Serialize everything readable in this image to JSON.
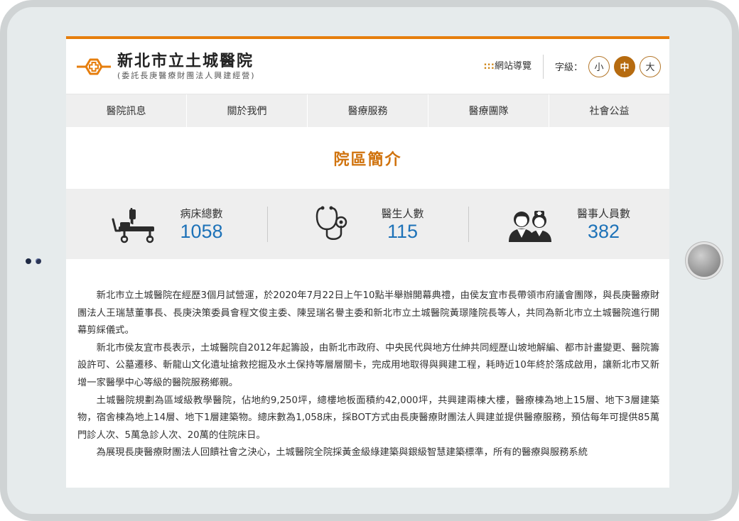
{
  "header": {
    "title": "新北市立土城醫院",
    "subtitle": "(委託長庚醫療財團法人興建經營)",
    "sitemap_dots": ":::",
    "sitemap_label": "網站導覽",
    "font_size_label": "字級：",
    "font_sizes": [
      "小",
      "中",
      "大"
    ],
    "active_font_size": "中",
    "accent_color": "#e67e0d"
  },
  "nav": {
    "items": [
      "醫院訊息",
      "關於我們",
      "醫療服務",
      "醫療團隊",
      "社會公益"
    ]
  },
  "page": {
    "title": "院區簡介"
  },
  "stats": [
    {
      "label": "病床總數",
      "value": "1058",
      "icon": "hospital-bed-icon"
    },
    {
      "label": "醫生人數",
      "value": "115",
      "icon": "stethoscope-icon"
    },
    {
      "label": "醫事人員數",
      "value": "382",
      "icon": "medical-staff-icon"
    }
  ],
  "article": {
    "paragraphs": [
      "新北市立土城醫院在經歷3個月試營運，於2020年7月22日上午10點半舉辦開幕典禮，由侯友宜市長帶領市府議會團隊，與長庚醫療財團法人王瑞慧董事長、長庚決策委員會程文俊主委、陳昱瑞名譽主委和新北市立土城醫院黃璟隆院長等人，共同為新北市立土城醫院進行開幕剪綵儀式。",
      "新北市侯友宜市長表示，土城醫院自2012年起籌設，由新北市政府、中央民代與地方仕紳共同經歷山坡地解編、都市計畫變更、醫院籌設許可、公墓遷移、斬龍山文化遺址搶救挖掘及水土保持等層層關卡，完成用地取得與興建工程，耗時近10年終於落成啟用，讓新北市又新增一家醫學中心等級的醫院服務鄉親。",
      "土城醫院規劃為區域級教學醫院，佔地約9,250坪，總樓地板面積約42,000坪，共興建兩棟大樓，醫療棟為地上15層、地下3層建築物，宿舍棟為地上14層、地下1層建築物。總床數為1,058床，採BOT方式由長庚醫療財團法人興建並提供醫療服務，預估每年可提供85萬門診人次、5萬急診人次、20萬的住院床日。",
      "為展現長庚醫療財團法人回饋社會之決心，土城醫院全院採黃金級綠建築與銀級智慧建築標準，所有的醫療與服務系統"
    ]
  }
}
